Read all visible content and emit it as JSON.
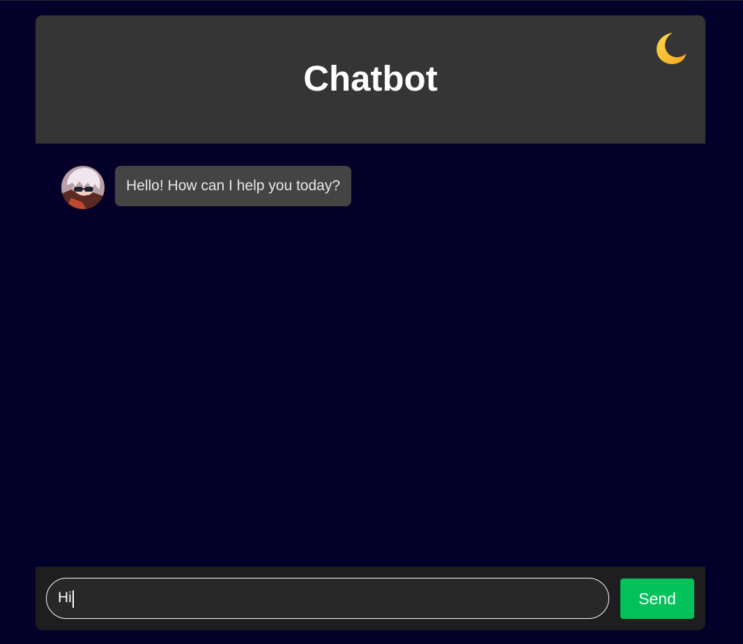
{
  "header": {
    "title": "Chatbot",
    "theme_icon": "crescent-moon-icon",
    "theme_icon_color": "#f5c02a"
  },
  "messages": [
    {
      "sender": "bot",
      "avatar": "anime-avatar",
      "text": "Hello! How can I help you today?"
    }
  ],
  "composer": {
    "value": "Hi",
    "send_label": "Send",
    "send_color": "#00c15a"
  },
  "colors": {
    "page_background": "#05002a",
    "header_background": "#353535",
    "bubble_background": "#444444",
    "input_bar_background": "#1e1e1e"
  }
}
